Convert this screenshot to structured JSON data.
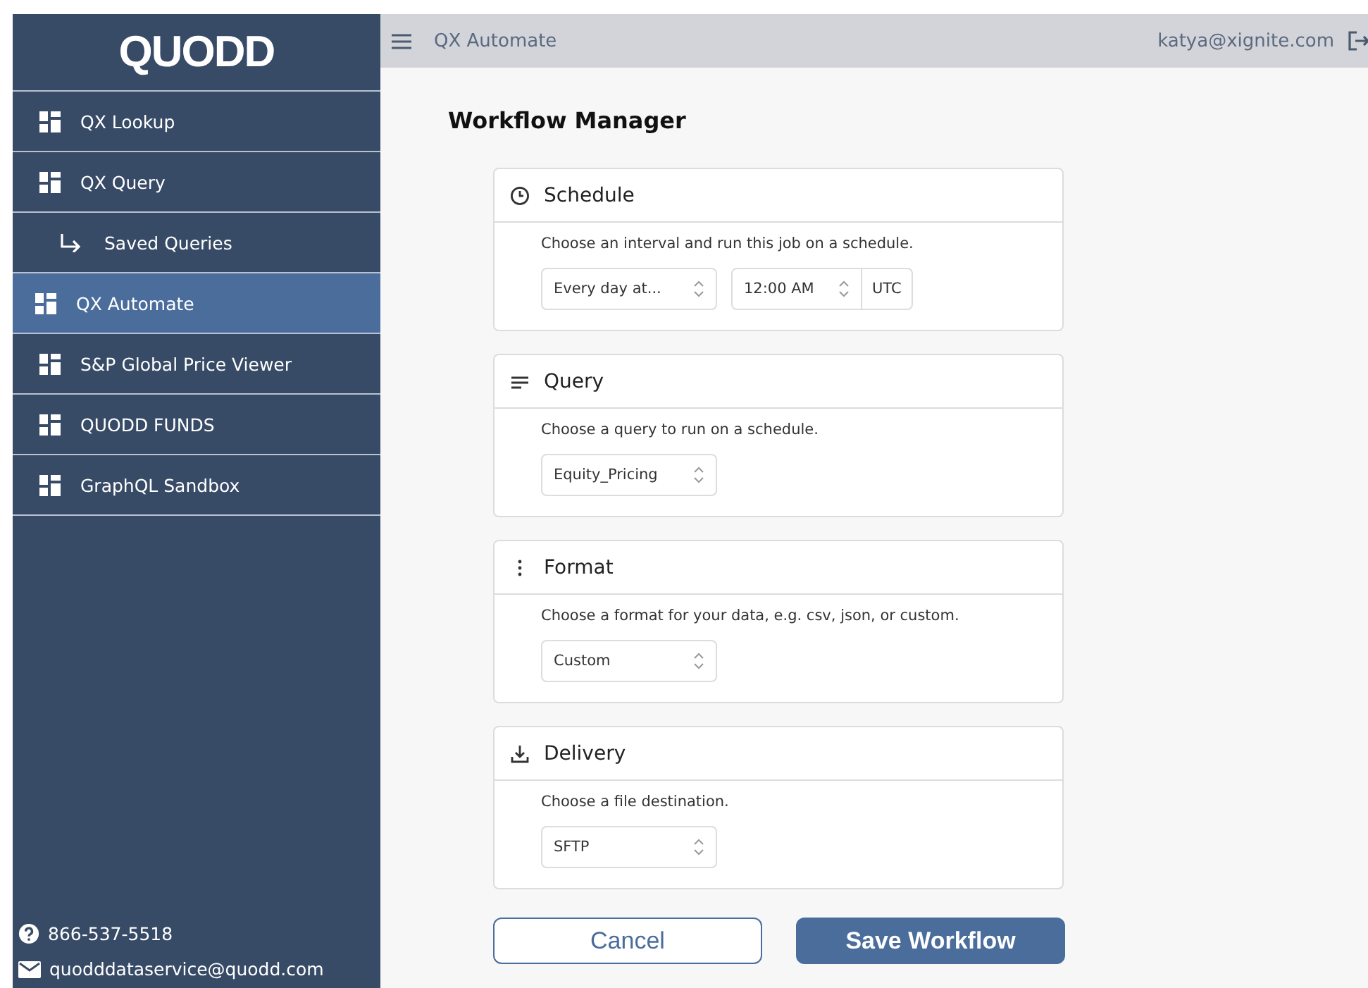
{
  "sidebar": {
    "logo": "QUODD",
    "items": [
      {
        "label": "QX Lookup",
        "kind": "page",
        "selected": false
      },
      {
        "label": "QX Query",
        "kind": "page",
        "selected": false
      },
      {
        "label": "Saved Queries",
        "kind": "sub",
        "selected": false
      },
      {
        "label": "QX Automate",
        "kind": "page",
        "selected": true
      },
      {
        "label": "S&P Global Price Viewer",
        "kind": "page",
        "selected": false
      },
      {
        "label": "QUODD FUNDS",
        "kind": "page",
        "selected": false
      },
      {
        "label": "GraphQL Sandbox",
        "kind": "page",
        "selected": false
      }
    ],
    "contacts": [
      {
        "kind": "phone",
        "text": "866-537-5518"
      },
      {
        "kind": "email",
        "text": "quodddataservice@quodd.com"
      }
    ]
  },
  "header": {
    "title": "QX Automate",
    "user": "katya@xignite.com"
  },
  "page_title": "Workflow Manager",
  "sections": [
    {
      "kind": "clock",
      "title": "Schedule",
      "description": "Choose an interval and run this job on a schedule.",
      "controls": [
        {
          "value": "Every day at..."
        },
        {
          "value": "12:00 AM",
          "suffix": "UTC"
        }
      ]
    },
    {
      "kind": "lines",
      "title": "Query",
      "description": "Choose a query to run on a schedule.",
      "controls": [
        {
          "value": "Equity_Pricing"
        }
      ]
    },
    {
      "kind": "dots",
      "title": "Format",
      "description": "Choose a format for your data, e.g. csv, json, or custom.",
      "controls": [
        {
          "value": "Custom"
        }
      ]
    },
    {
      "kind": "download",
      "title": "Delivery",
      "description": "Choose a file destination.",
      "controls": [
        {
          "value": "SFTP"
        }
      ]
    }
  ],
  "buttons": [
    {
      "label": "Cancel",
      "kind": "secondary"
    },
    {
      "label": "Save Workflow",
      "kind": "primary"
    }
  ]
}
